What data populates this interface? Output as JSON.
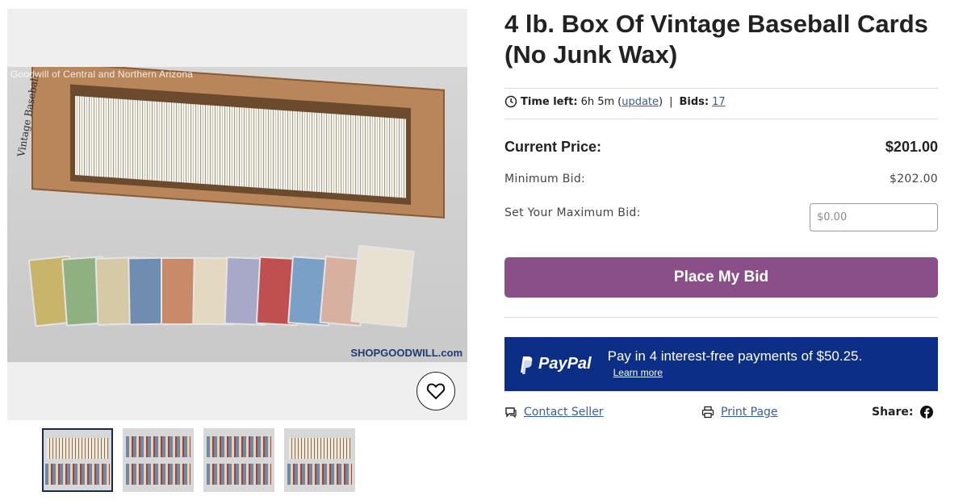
{
  "gallery": {
    "watermark": "Goodwill of Central and Northern Arizona",
    "box_writing": "Vintage Baseball",
    "brand_mark": "SHOPGOODWILL.com",
    "favorite_icon": "heart-icon",
    "thumbnails": [
      "thumb-1",
      "thumb-2",
      "thumb-3",
      "thumb-4"
    ],
    "active_thumbnail": 0
  },
  "listing": {
    "title": "4 lb. Box Of Vintage Baseball Cards (No Junk Wax)",
    "time_left_label": "Time left:",
    "time_left_value": "6h 5m",
    "update_link": "update",
    "separator": "|",
    "bids_label": "Bids:",
    "bids_value": "17"
  },
  "pricing": {
    "current_price_label": "Current Price:",
    "current_price_value": "$201.00",
    "minimum_bid_label": "Minimum Bid:",
    "minimum_bid_value": "$202.00",
    "max_bid_label": "Set Your Maximum Bid:",
    "max_bid_placeholder": "$0.00",
    "place_bid_button": "Place My Bid"
  },
  "paypal": {
    "logo_text": "PayPal",
    "message": "Pay in 4 interest-free payments of $50.25.",
    "learn_more": "Learn more"
  },
  "actions": {
    "contact_seller": "Contact Seller",
    "print_page": "Print Page",
    "share_label": "Share:"
  },
  "colors": {
    "bid_button": "#8a4f88",
    "paypal_banner": "#0c2e84",
    "link": "#3b5c9c"
  }
}
